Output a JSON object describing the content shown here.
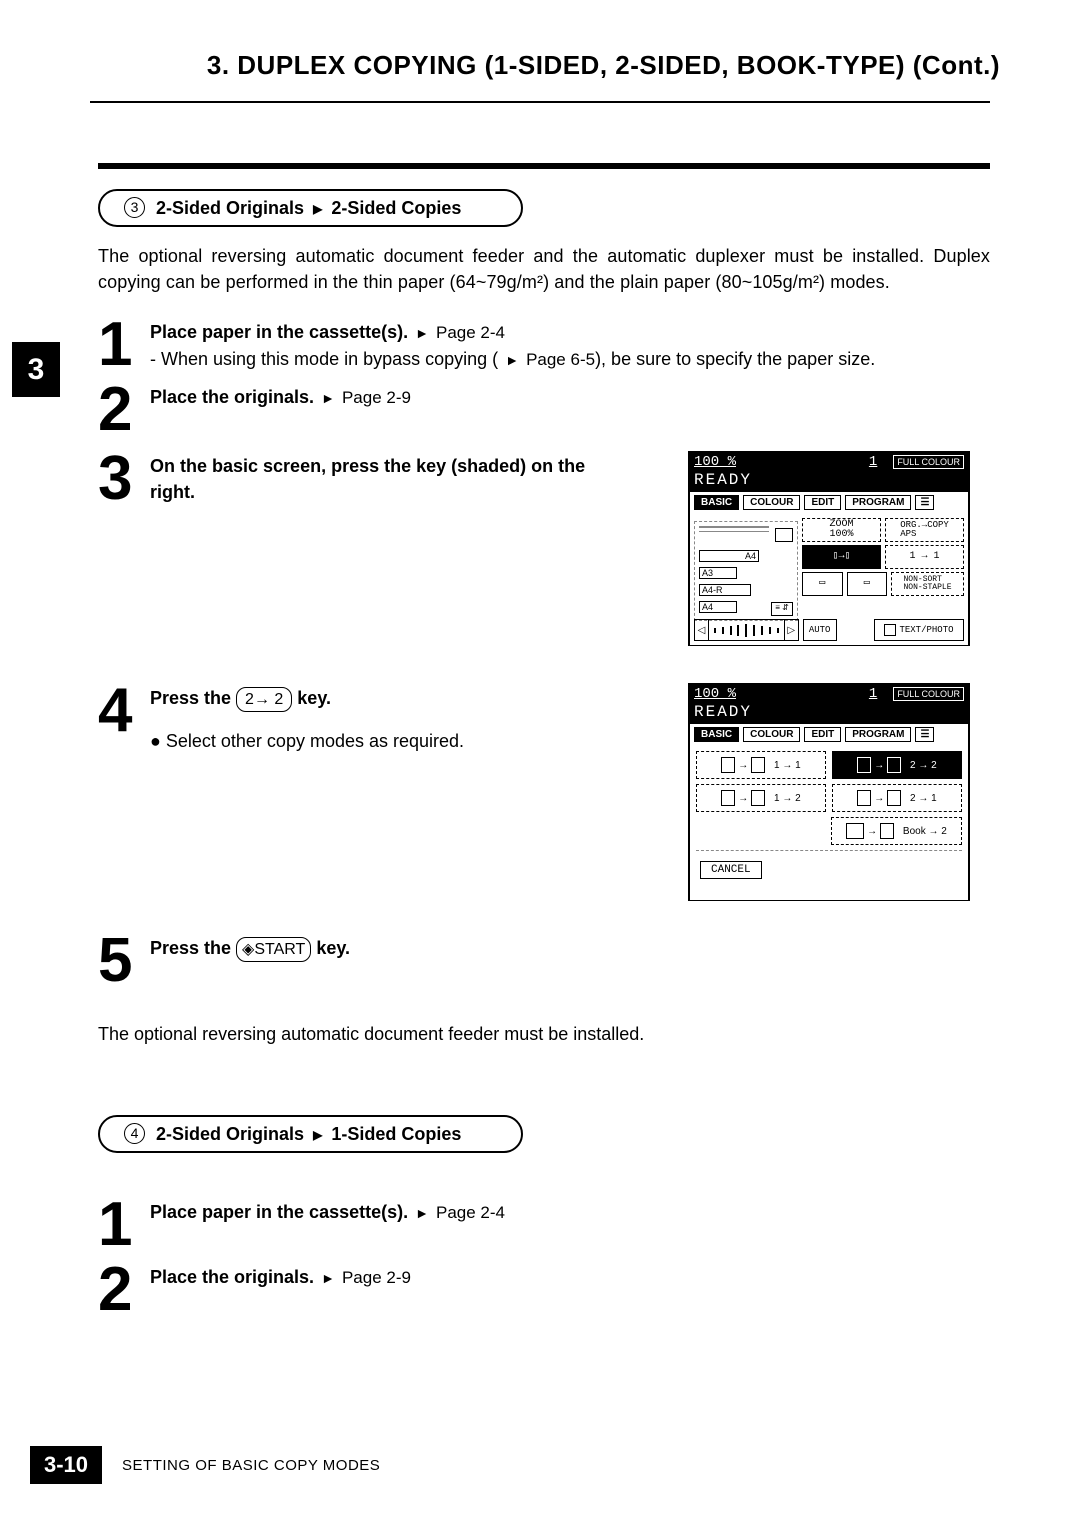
{
  "header": {
    "title": "3. DUPLEX COPYING (1-SIDED, 2-SIDED, BOOK-TYPE) (Cont.)"
  },
  "section3": {
    "badge_num": "3",
    "title_a": "2-Sided Originals",
    "title_b": "2-Sided Copies",
    "intro": "The optional reversing automatic document feeder and the automatic duplexer must be installed. Duplex copying can be performed in the thin paper (64~79g/m²) and the plain paper (80~105g/m²) modes.",
    "step1": {
      "num": "1",
      "bold": "Place paper in the cassette(s).",
      "ref": "Page 2-4",
      "sub": "- When using this mode in bypass copying (",
      "sub_ref": "Page 6-5",
      "sub_tail": "), be sure to specify the paper size."
    },
    "step2": {
      "num": "2",
      "bold": "Place the originals.",
      "ref": "Page 2-9"
    },
    "step3": {
      "num": "3",
      "bold": "On the basic screen, press the key (shaded) on the right."
    },
    "step4": {
      "num": "4",
      "bold_a": "Press the ",
      "key": "2→ 2",
      "bold_b": " key.",
      "bullet": "Select other copy modes as required."
    },
    "step5": {
      "num": "5",
      "bold_a": "Press the ",
      "start": "START",
      "bold_b": " key."
    },
    "note": "The optional reversing automatic document feeder must be installed."
  },
  "section4": {
    "badge_num": "4",
    "title_a": "2-Sided Originals",
    "title_b": "1-Sided Copies",
    "step1": {
      "num": "1",
      "bold": "Place paper in the cassette(s).",
      "ref": "Page 2-4"
    },
    "step2": {
      "num": "2",
      "bold": "Place the originals.",
      "ref": "Page 2-9"
    }
  },
  "lcd": {
    "pct": "100  %",
    "one": "1",
    "fc": "FULL COLOUR",
    "ready": "READY",
    "tabs": {
      "basic": "BASIC",
      "colour": "COLOUR",
      "edit": "EDIT",
      "program": "PROGRAM"
    },
    "zoom": "ZOOM\n100%",
    "org": "ORG.→COPY\nAPS",
    "a4": "A4",
    "a3": "A3",
    "a4r": "A4-R",
    "a4b": "A4",
    "one2one": "1 → 1",
    "nonsort": "NON-SORT\nNON-STAPLE",
    "auto": "AUTO",
    "tp": "TEXT/PHOTO",
    "dup": {
      "d11": "1 → 1",
      "d22": "2 → 2",
      "d12": "1 → 2",
      "d21": "2 → 1",
      "book": "Book → 2"
    },
    "cancel": "CANCEL"
  },
  "chapter_tab": "3",
  "footer": {
    "page": "3-10",
    "text": "SETTING OF BASIC COPY MODES"
  }
}
